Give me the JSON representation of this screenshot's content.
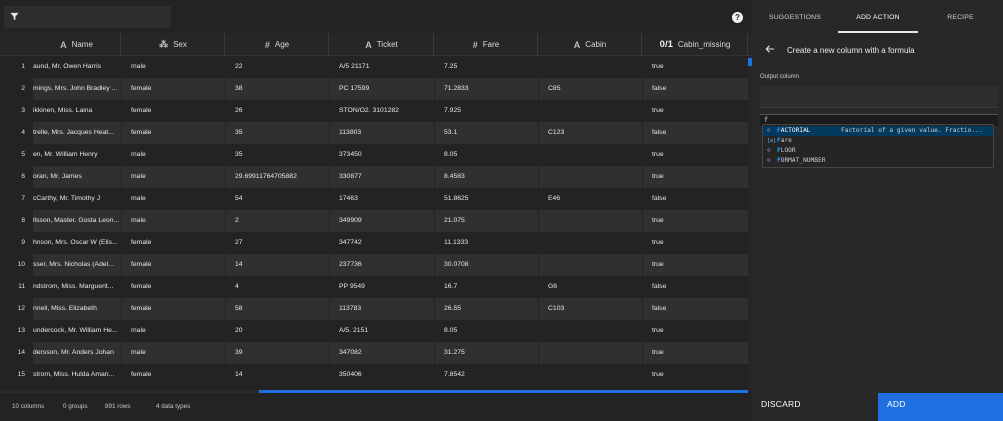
{
  "toolbar": {
    "help_icon": "help-circle-icon",
    "filter_icon": "filter-icon"
  },
  "columns": [
    {
      "type_icon": "A",
      "label": "Name"
    },
    {
      "type_icon": "⁂",
      "label": "Sex"
    },
    {
      "type_icon": "#",
      "label": "Age"
    },
    {
      "type_icon": "A",
      "label": "Ticket"
    },
    {
      "type_icon": "#",
      "label": "Fare"
    },
    {
      "type_icon": "A",
      "label": "Cabin"
    },
    {
      "type_icon": "0/1",
      "label": "Cabin_missing"
    }
  ],
  "rows": [
    {
      "idx": "1",
      "name": "aund, Mr. Owen Harris",
      "sex": "male",
      "age": "22",
      "ticket": "A/5 21171",
      "fare": "7.25",
      "cabin": "",
      "cabin_missing": "true"
    },
    {
      "idx": "2",
      "name": "mings, Mrs. John Bradley ...",
      "sex": "female",
      "age": "38",
      "ticket": "PC 17599",
      "fare": "71.2833",
      "cabin": "C85",
      "cabin_missing": "false"
    },
    {
      "idx": "3",
      "name": "ikkinen, Miss. Laina",
      "sex": "female",
      "age": "26",
      "ticket": "STON/O2. 3101282",
      "fare": "7.925",
      "cabin": "",
      "cabin_missing": "true"
    },
    {
      "idx": "4",
      "name": "trelle, Mrs. Jacques Heat...",
      "sex": "female",
      "age": "35",
      "ticket": "113803",
      "fare": "53.1",
      "cabin": "C123",
      "cabin_missing": "false"
    },
    {
      "idx": "5",
      "name": "en, Mr. William Henry",
      "sex": "male",
      "age": "35",
      "ticket": "373450",
      "fare": "8.05",
      "cabin": "",
      "cabin_missing": "true"
    },
    {
      "idx": "6",
      "name": "oran, Mr. James",
      "sex": "male",
      "age": "29.69911764705882",
      "ticket": "330877",
      "fare": "8.4583",
      "cabin": "",
      "cabin_missing": "true"
    },
    {
      "idx": "7",
      "name": "cCarthy, Mr. Timothy J",
      "sex": "male",
      "age": "54",
      "ticket": "17463",
      "fare": "51.8625",
      "cabin": "E46",
      "cabin_missing": "false"
    },
    {
      "idx": "8",
      "name": "llsson, Master. Gosta Leon...",
      "sex": "male",
      "age": "2",
      "ticket": "349909",
      "fare": "21.075",
      "cabin": "",
      "cabin_missing": "true"
    },
    {
      "idx": "9",
      "name": "hnson, Mrs. Oscar W (Elis...",
      "sex": "female",
      "age": "27",
      "ticket": "347742",
      "fare": "11.1333",
      "cabin": "",
      "cabin_missing": "true"
    },
    {
      "idx": "10",
      "name": "sser, Mrs. Nicholas (Adel...",
      "sex": "female",
      "age": "14",
      "ticket": "237736",
      "fare": "30.0708",
      "cabin": "",
      "cabin_missing": "true"
    },
    {
      "idx": "11",
      "name": "ndstrom, Miss. Marguerit...",
      "sex": "female",
      "age": "4",
      "ticket": "PP 9549",
      "fare": "16.7",
      "cabin": "G6",
      "cabin_missing": "false"
    },
    {
      "idx": "12",
      "name": "nnell, Miss. Elizabeth",
      "sex": "female",
      "age": "58",
      "ticket": "113783",
      "fare": "26.55",
      "cabin": "C103",
      "cabin_missing": "false"
    },
    {
      "idx": "13",
      "name": "undercock, Mr. William He...",
      "sex": "male",
      "age": "20",
      "ticket": "A/5. 2151",
      "fare": "8.05",
      "cabin": "",
      "cabin_missing": "true"
    },
    {
      "idx": "14",
      "name": "dersson, Mr. Anders Johan",
      "sex": "male",
      "age": "39",
      "ticket": "347082",
      "fare": "31.275",
      "cabin": "",
      "cabin_missing": "true"
    },
    {
      "idx": "15",
      "name": "strom, Miss. Hulda Aman...",
      "sex": "female",
      "age": "14",
      "ticket": "350406",
      "fare": "7.8542",
      "cabin": "",
      "cabin_missing": "true"
    }
  ],
  "footer": {
    "columns": "10 columns",
    "groups": "0 groups",
    "rows": "891 rows",
    "types": "4 data types"
  },
  "panel": {
    "tabs": [
      "SUGGESTIONS",
      "ADD ACTION",
      "RECIPE"
    ],
    "active_tab": "ADD ACTION",
    "title": "Create a new column with a formula",
    "output_label": "Output column",
    "output_value": "",
    "formula_value": "f",
    "suggestions": [
      {
        "kind": "function",
        "match": "F",
        "rest": "ACTORIAL",
        "desc": "Factorial of a given value. Fractio..."
      },
      {
        "kind": "variable",
        "match": "F",
        "rest": "are",
        "desc": ""
      },
      {
        "kind": "function",
        "match": "F",
        "rest": "LOOR",
        "desc": ""
      },
      {
        "kind": "function",
        "match": "F",
        "rest": "ORMAT_NUMBER",
        "desc": ""
      }
    ],
    "discard_label": "DISCARD",
    "add_label": "ADD"
  },
  "colors": {
    "accent": "#1f6fe0",
    "background": "#232323",
    "panel": "#282828",
    "row_alt": "#303030",
    "suggest_selected": "#04395e"
  }
}
